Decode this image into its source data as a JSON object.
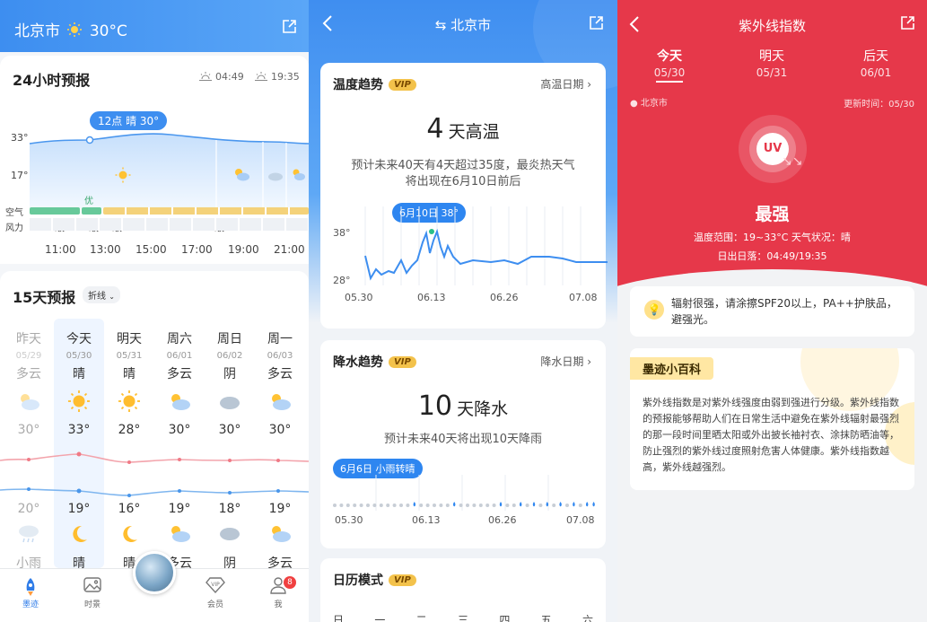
{
  "screen1": {
    "header": {
      "city": "北京市",
      "temp": "30°C",
      "icon_weather": "sun-icon",
      "icon_share": "share-icon"
    },
    "hourly": {
      "title": "24小时预报",
      "sunrise": "04:49",
      "sunset": "19:35",
      "bubble": "12点 晴 30°",
      "y_high": "33°",
      "y_low": "17°",
      "aqi_label": "空气",
      "aqi_badge": "优",
      "wind_label": "风力",
      "wind_levels": [
        "3级",
        "4级",
        "3级",
        "4级"
      ],
      "times": [
        "11:00",
        "13:00",
        "15:00",
        "17:00",
        "19:00",
        "21:00"
      ]
    },
    "daily": {
      "title": "15天预报",
      "mode": "折线",
      "days": [
        {
          "day": "昨天",
          "date": "05/29",
          "weather": "多云",
          "high": "30°",
          "low": "20°",
          "night": "小雨"
        },
        {
          "day": "今天",
          "date": "05/30",
          "weather": "晴",
          "high": "33°",
          "low": "19°",
          "night": "晴"
        },
        {
          "day": "明天",
          "date": "05/31",
          "weather": "晴",
          "high": "28°",
          "low": "16°",
          "night": "晴"
        },
        {
          "day": "周六",
          "date": "06/01",
          "weather": "多云",
          "high": "30°",
          "low": "19°",
          "night": "多云"
        },
        {
          "day": "周日",
          "date": "06/02",
          "weather": "阴",
          "high": "30°",
          "low": "18°",
          "night": "阴"
        },
        {
          "day": "周一",
          "date": "06/03",
          "weather": "多云",
          "high": "30°",
          "low": "19°",
          "night": "多云"
        }
      ]
    },
    "tabbar": {
      "items": [
        {
          "label": "墨迹"
        },
        {
          "label": "时景"
        },
        {
          "label": "会员"
        },
        {
          "label": "我"
        }
      ],
      "badge": "8"
    }
  },
  "screen2": {
    "header": {
      "title": "北京市"
    },
    "temp_card": {
      "title": "温度趋势",
      "vip": "VIP",
      "link": "高温日期",
      "num": "4",
      "unit": "天高温",
      "desc": "预计未来40天有4天超过35度，最炎热天气将出现在6月10日前后",
      "pill": "6月10日 38°",
      "y_high": "38°",
      "y_low": "28°",
      "x_labels": [
        "05.30",
        "06.13",
        "06.26",
        "07.08"
      ]
    },
    "rain_card": {
      "title": "降水趋势",
      "vip": "VIP",
      "link": "降水日期",
      "num": "10",
      "unit": "天降水",
      "desc": "预计未来40天将出现10天降雨",
      "pill": "6月6日 小雨转晴",
      "x_labels": [
        "05.30",
        "06.13",
        "06.26",
        "07.08"
      ]
    },
    "cal_card": {
      "title": "日历模式",
      "vip": "VIP",
      "weekdays": [
        "日",
        "一",
        "二",
        "三",
        "四",
        "五",
        "六"
      ]
    }
  },
  "screen3": {
    "header": {
      "title": "紫外线指数"
    },
    "tabs": [
      {
        "label": "今天",
        "date": "05/30"
      },
      {
        "label": "明天",
        "date": "05/31"
      },
      {
        "label": "后天",
        "date": "06/01"
      }
    ],
    "location": "北京市",
    "update": "更新时间：05/30",
    "uv_badge": "UV",
    "level": "最强",
    "temp_range": "温度范围：19~33°C  天气状况：晴",
    "sun_times": "日出日落：04:49/19:35",
    "advice": "辐射很强，请涂擦SPF20以上，PA++护肤品，避强光。",
    "encyclopedia": {
      "title": "墨迹小百科",
      "text": "紫外线指数是对紫外线强度由弱到强进行分级。紫外线指数的预报能够帮助人们在日常生活中避免在紫外线辐射最强烈的那一段时间里晒太阳或外出披长袖衬衣、涂抹防晒油等，防止强烈的紫外线过度照射危害人体健康。紫外线指数越高，紫外线越强烈。"
    }
  }
}
